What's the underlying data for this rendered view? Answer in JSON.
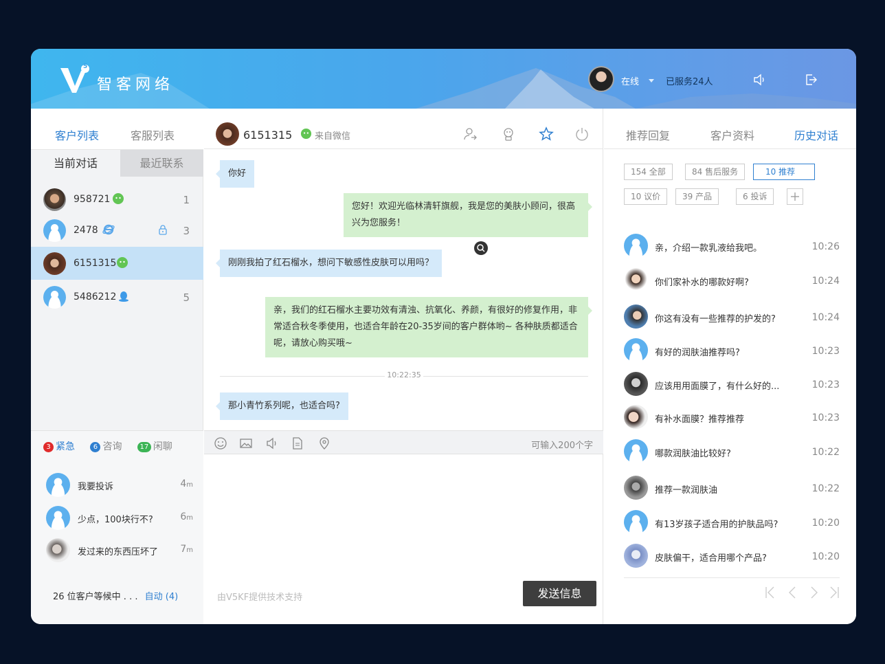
{
  "header": {
    "logo_badge": "5",
    "brand": "智客网络",
    "status": "在线",
    "served": "已服务24人",
    "icons": [
      "speaker-icon",
      "logout-icon"
    ]
  },
  "left": {
    "tabs": [
      "客户列表",
      "客服列表"
    ],
    "subtabs": [
      "当前对话",
      "最近联系"
    ],
    "customers": [
      {
        "id": "958721",
        "source": "wechat",
        "count": "1"
      },
      {
        "id": "2478",
        "source": "ie",
        "locked": true,
        "count": "3"
      },
      {
        "id": "6151315",
        "source": "wechat",
        "count": "",
        "selected": true
      },
      {
        "id": "5486212",
        "source": "qq",
        "count": "5"
      }
    ],
    "categories": [
      {
        "count": "3",
        "label": "紧急",
        "color": "#e02b2b"
      },
      {
        "count": "6",
        "label": "咨询",
        "color": "#2e7fd0"
      },
      {
        "count": "17",
        "label": "闲聊",
        "color": "#3cb455"
      }
    ],
    "waiting_items": [
      {
        "text": "我要投诉",
        "num": "4",
        "unit": "m"
      },
      {
        "text": "少点，100块行不?",
        "num": "6",
        "unit": "m"
      },
      {
        "text": "发过来的东西压坏了",
        "num": "7",
        "unit": "m"
      }
    ],
    "waiting_text": "26 位客户等候中 . . .",
    "auto_text": "自动 (4)"
  },
  "chat": {
    "user_id": "6151315",
    "from": "来自微信",
    "messages": [
      {
        "dir": "in",
        "text": "你好"
      },
      {
        "dir": "out",
        "text": "您好！欢迎光临林清轩旗舰，我是您的美肤小顾问，很高兴为您服务！"
      },
      {
        "dir": "in",
        "text": "刚刚我拍了红石榴水，想问下敏感性皮肤可以用吗？"
      },
      {
        "dir": "out",
        "text": "亲，我们的红石榴水主要功效有清浊、抗氧化、养颜，有很好的修复作用，非常适合秋冬季使用，也适合年龄在20-35岁间的客户群体哟~ 各种肤质都适合呢，请放心购买哦~"
      },
      {
        "dir": "in",
        "text": "那小青竹系列呢，也适合吗?"
      }
    ],
    "timestamp": "10:22:35",
    "char_limit": "可输入200个字",
    "powered": "由V5KF提供技术支持",
    "send_label": "发送信息"
  },
  "right": {
    "tabs": [
      "推荐回复",
      "客户资料",
      "历史对话"
    ],
    "active_tab": 2,
    "tags": [
      "154 全部",
      "84 售后服务",
      "10 推荐",
      "10 议价",
      "39 产品",
      "6 投诉"
    ],
    "active_tag": 2,
    "history": [
      {
        "q": "亲，介绍一款乳液给我吧。",
        "t": "10:26"
      },
      {
        "q": "你们家补水的哪款好啊?",
        "t": "10:24"
      },
      {
        "q": "你这有没有一些推荐的护发的?",
        "t": "10:24"
      },
      {
        "q": "有好的润肤油推荐吗?",
        "t": "10:23"
      },
      {
        "q": "应该用用面膜了，有什么好的...",
        "t": "10:23"
      },
      {
        "q": "有补水面膜？推荐推荐",
        "t": "10:23"
      },
      {
        "q": "哪款润肤油比较好?",
        "t": "10:22"
      },
      {
        "q": "推荐一款润肤油",
        "t": "10:22"
      },
      {
        "q": "有13岁孩子适合用的护肤品吗?",
        "t": "10:20"
      },
      {
        "q": "皮肤偏干，适合用哪个产品?",
        "t": "10:20"
      }
    ]
  },
  "colors": {
    "accent": "#2e7fd0",
    "selected_row": "#c5e1f7",
    "in_bubble": "#d5eafa",
    "out_bubble": "#d4f0cf",
    "send_button": "#3e3e3e"
  }
}
